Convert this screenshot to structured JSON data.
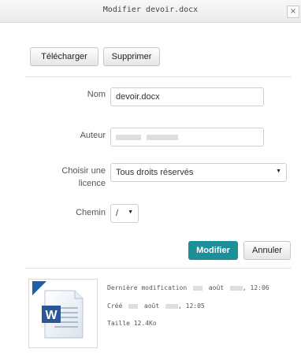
{
  "dialog": {
    "title": "Modifier devoir.docx",
    "close_label": "×"
  },
  "toolbar": {
    "download_label": "Télécharger",
    "delete_label": "Supprimer"
  },
  "form": {
    "name_label": "Nom",
    "name_value": "devoir.docx",
    "author_label": "Auteur",
    "license_label_line1": "Choisir une",
    "license_label_line2": "licence",
    "license_value": "Tous droits réservés",
    "path_label": "Chemin",
    "path_value": "/"
  },
  "actions": {
    "update_label": "Modifier",
    "cancel_label": "Annuler"
  },
  "file_info": {
    "modified_label": "Dernière modification",
    "modified_month": "août",
    "modified_time": ", 12:06",
    "created_label": "Créé",
    "created_month": "août",
    "created_time": ", 12:05",
    "size_label": "Taille",
    "size_value": "12.4Ko"
  },
  "icons": {
    "file": "word-document-icon",
    "select_caret": "caret-down-icon"
  },
  "colors": {
    "primary": "#1d8f99",
    "word_blue": "#2a5699"
  }
}
